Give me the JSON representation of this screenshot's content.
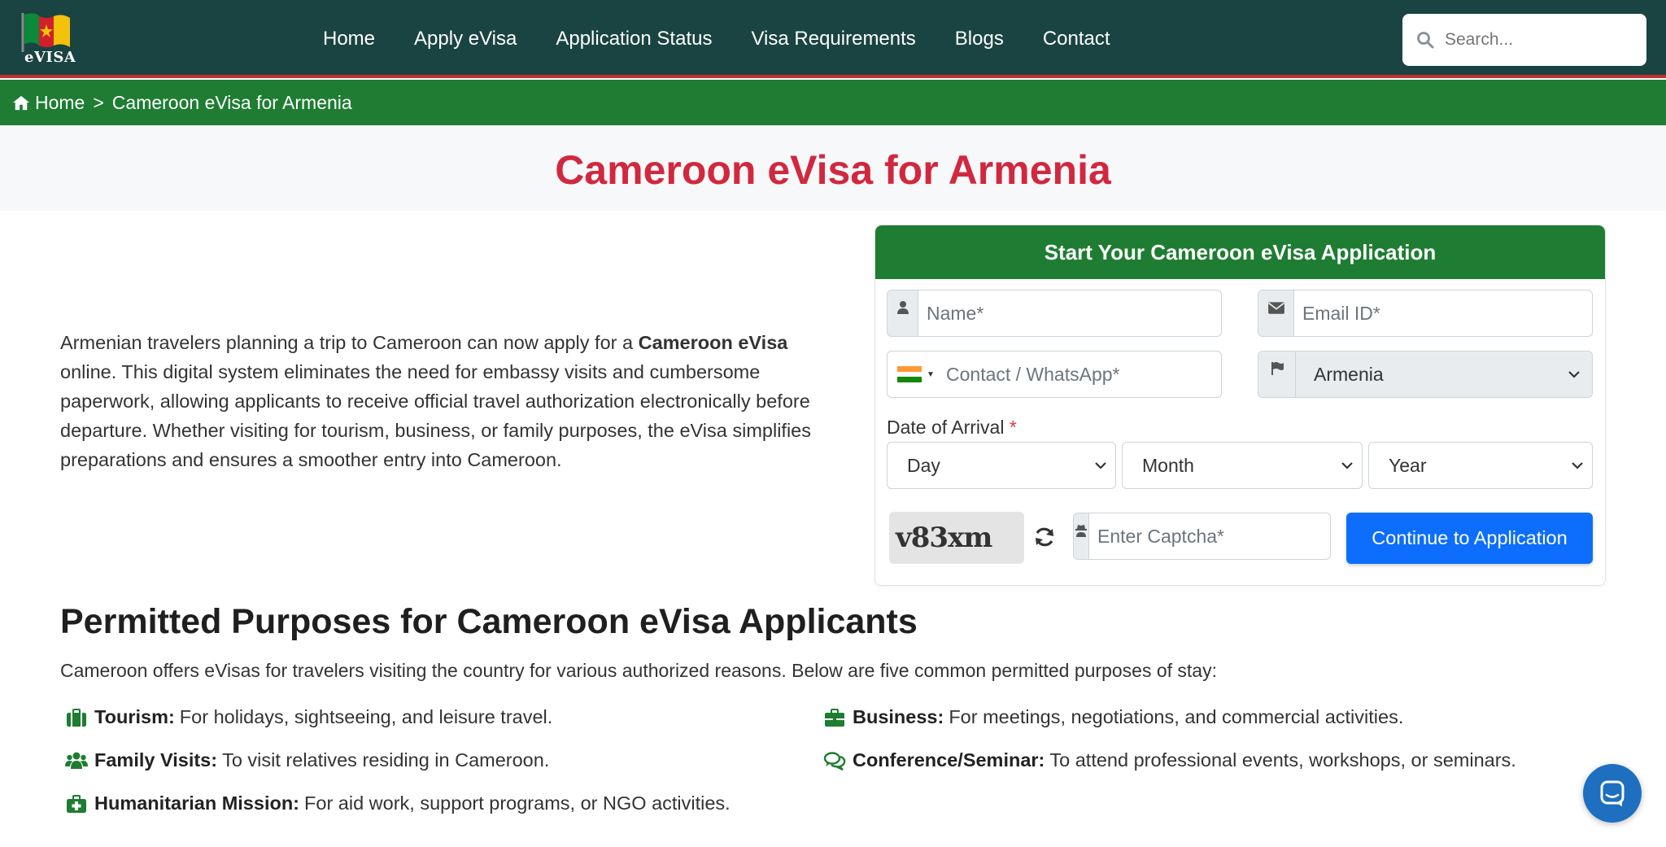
{
  "header": {
    "logo_text": "eVISA",
    "nav": [
      {
        "label": "Home"
      },
      {
        "label": "Apply eVisa"
      },
      {
        "label": "Application Status"
      },
      {
        "label": "Visa Requirements"
      },
      {
        "label": "Blogs"
      },
      {
        "label": "Contact"
      }
    ],
    "search_placeholder": "Search..."
  },
  "breadcrumb": {
    "home": "Home",
    "separator": ">",
    "current": "Cameroon eVisa for Armenia"
  },
  "page_title": "Cameroon eVisa for Armenia",
  "intro": {
    "before": "Armenian travelers planning a trip to Cameroon can now apply for a ",
    "bold": "Cameroon eVisa",
    "after": " online. This digital system eliminates the need for embassy visits and cumbersome paperwork, allowing applicants to receive official travel authorization electronically before departure. Whether visiting for tourism, business, or family purposes, the eVisa simplifies preparations and ensures a smoother entry into Cameroon."
  },
  "form": {
    "title": "Start Your Cameroon eVisa Application",
    "name_placeholder": "Name*",
    "email_placeholder": "Email ID*",
    "phone_placeholder": "Contact / WhatsApp*",
    "country_value": "Armenia",
    "date_label": "Date of Arrival",
    "required_mark": "*",
    "day": "Day",
    "month": "Month",
    "year": "Year",
    "captcha_text": "v83xm",
    "captcha_placeholder": "Enter Captcha*",
    "submit_label": "Continue to Application"
  },
  "purposes": {
    "heading": "Permitted Purposes for Cameroon eVisa Applicants",
    "intro": "Cameroon offers eVisas for travelers visiting the country for various authorized reasons. Below are five common permitted purposes of stay:",
    "items": [
      {
        "title": "Tourism:",
        "text": "For holidays, sightseeing, and leisure travel.",
        "icon": "suitcase-icon"
      },
      {
        "title": "Business:",
        "text": "For meetings, negotiations, and commercial activities.",
        "icon": "briefcase-icon"
      },
      {
        "title": "Family Visits:",
        "text": "To visit relatives residing in Cameroon.",
        "icon": "users-icon"
      },
      {
        "title": "Conference/Seminar:",
        "text": "To attend professional events, workshops, or seminars.",
        "icon": "comments-icon"
      },
      {
        "title": "Humanitarian Mission:",
        "text": "For aid work, support programs, or NGO activities.",
        "icon": "medkit-icon"
      }
    ]
  },
  "colors": {
    "header_bg": "#194441",
    "header_border": "#c62f2f",
    "breadcrumb_bg": "#1e7d32",
    "title": "#d1283f",
    "card_head": "#1e7d32",
    "button": "#0d6efd",
    "icon_green": "#1e7d32"
  }
}
